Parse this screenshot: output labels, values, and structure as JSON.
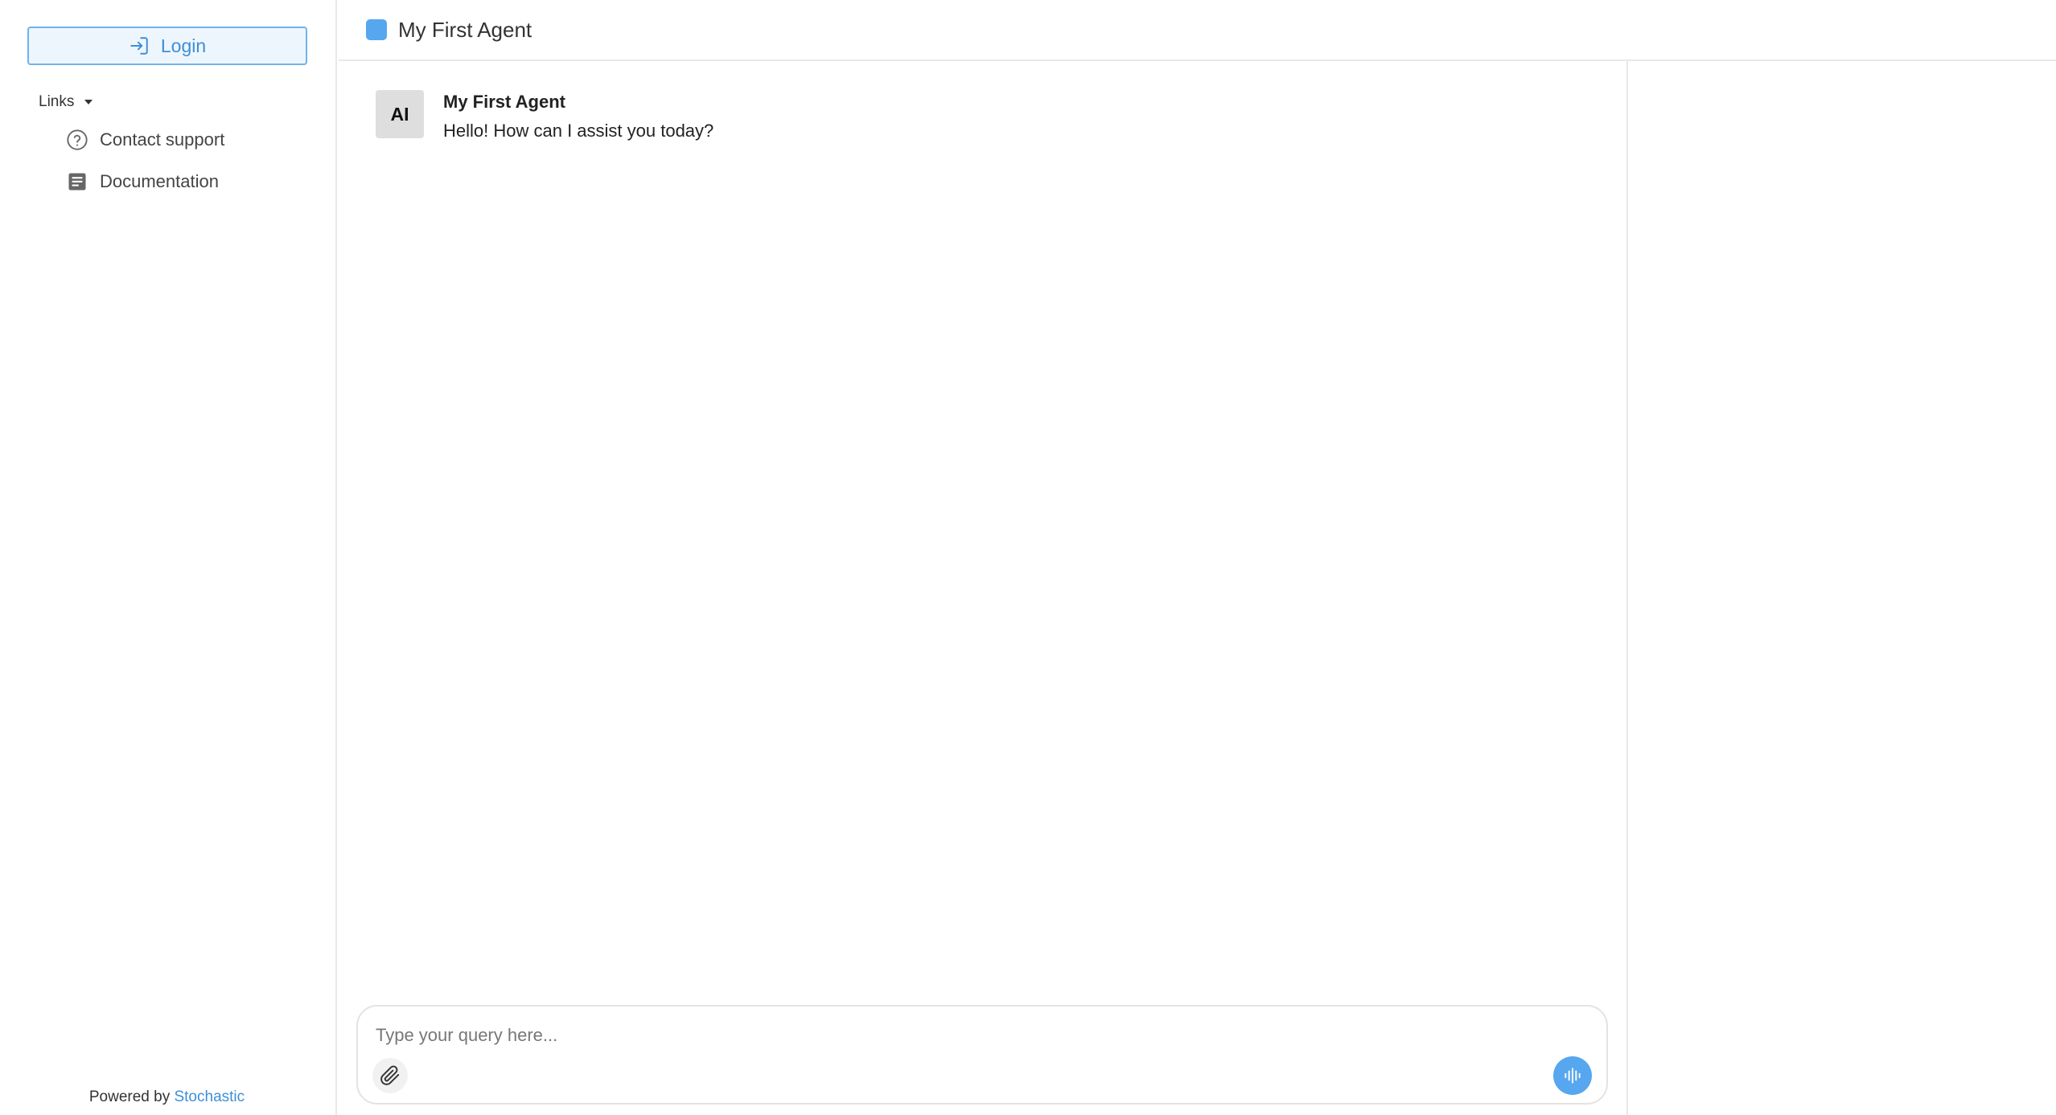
{
  "sidebar": {
    "login_label": "Login",
    "links_label": "Links",
    "links": [
      {
        "label": "Contact support",
        "icon": "help-circle-icon"
      },
      {
        "label": "Documentation",
        "icon": "document-icon"
      }
    ],
    "powered_by_prefix": "Powered by",
    "powered_by_brand": "Stochastic"
  },
  "header": {
    "title": "My First Agent"
  },
  "chat": {
    "messages": [
      {
        "avatar": "AI",
        "sender": "My First Agent",
        "text": "Hello! How can I assist you today?"
      }
    ]
  },
  "composer": {
    "placeholder": "Type your query here...",
    "value": ""
  },
  "colors": {
    "accent": "#56a7ef",
    "link": "#3d8fd8",
    "login_bg": "#eef6fd",
    "border": "#e9e9e9"
  }
}
